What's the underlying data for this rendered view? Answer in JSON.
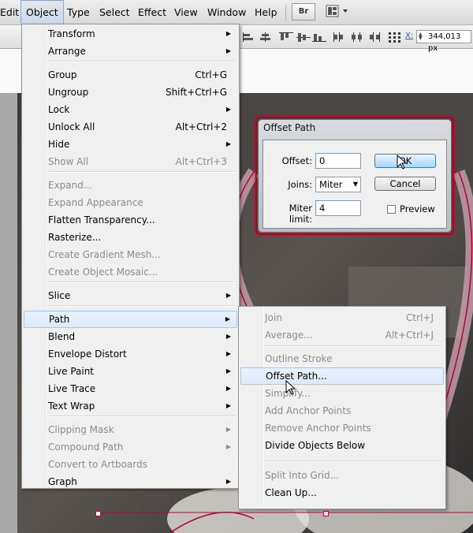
{
  "menubar": {
    "items": [
      "Edit",
      "Object",
      "Type",
      "Select",
      "Effect",
      "View",
      "Window",
      "Help"
    ],
    "active": "Object",
    "bridge_label": "Br"
  },
  "controlbar": {
    "x_label": "X:",
    "x_value": "344,013 px"
  },
  "object_menu": {
    "items": [
      {
        "label": "Transform",
        "shortcut": "",
        "submenu": true,
        "disabled": false
      },
      {
        "label": "Arrange",
        "shortcut": "",
        "submenu": true,
        "disabled": false
      },
      {
        "label": "Group",
        "shortcut": "Ctrl+G",
        "submenu": false,
        "disabled": false
      },
      {
        "label": "Ungroup",
        "shortcut": "Shift+Ctrl+G",
        "submenu": false,
        "disabled": false
      },
      {
        "label": "Lock",
        "shortcut": "",
        "submenu": true,
        "disabled": false
      },
      {
        "label": "Unlock All",
        "shortcut": "Alt+Ctrl+2",
        "submenu": false,
        "disabled": false
      },
      {
        "label": "Hide",
        "shortcut": "",
        "submenu": true,
        "disabled": false
      },
      {
        "label": "Show All",
        "shortcut": "Alt+Ctrl+3",
        "submenu": false,
        "disabled": true
      },
      {
        "label": "Expand...",
        "shortcut": "",
        "submenu": false,
        "disabled": true
      },
      {
        "label": "Expand Appearance",
        "shortcut": "",
        "submenu": false,
        "disabled": true
      },
      {
        "label": "Flatten Transparency...",
        "shortcut": "",
        "submenu": false,
        "disabled": false
      },
      {
        "label": "Rasterize...",
        "shortcut": "",
        "submenu": false,
        "disabled": false
      },
      {
        "label": "Create Gradient Mesh...",
        "shortcut": "",
        "submenu": false,
        "disabled": true
      },
      {
        "label": "Create Object Mosaic...",
        "shortcut": "",
        "submenu": false,
        "disabled": true
      },
      {
        "label": "Slice",
        "shortcut": "",
        "submenu": true,
        "disabled": false
      },
      {
        "label": "Path",
        "shortcut": "",
        "submenu": true,
        "disabled": false,
        "highlighted": true
      },
      {
        "label": "Blend",
        "shortcut": "",
        "submenu": true,
        "disabled": false
      },
      {
        "label": "Envelope Distort",
        "shortcut": "",
        "submenu": true,
        "disabled": false
      },
      {
        "label": "Live Paint",
        "shortcut": "",
        "submenu": true,
        "disabled": false
      },
      {
        "label": "Live Trace",
        "shortcut": "",
        "submenu": true,
        "disabled": false
      },
      {
        "label": "Text Wrap",
        "shortcut": "",
        "submenu": true,
        "disabled": false
      },
      {
        "label": "Clipping Mask",
        "shortcut": "",
        "submenu": true,
        "disabled": true
      },
      {
        "label": "Compound Path",
        "shortcut": "",
        "submenu": true,
        "disabled": true
      },
      {
        "label": "Convert to Artboards",
        "shortcut": "",
        "submenu": false,
        "disabled": true
      },
      {
        "label": "Graph",
        "shortcut": "",
        "submenu": true,
        "disabled": false
      }
    ]
  },
  "path_menu": {
    "items": [
      {
        "label": "Join",
        "shortcut": "Ctrl+J",
        "disabled": true
      },
      {
        "label": "Average...",
        "shortcut": "Alt+Ctrl+J",
        "disabled": true
      },
      {
        "label": "Outline Stroke",
        "shortcut": "",
        "disabled": true
      },
      {
        "label": "Offset Path...",
        "shortcut": "",
        "disabled": false,
        "highlighted": true
      },
      {
        "label": "Simplify...",
        "shortcut": "",
        "disabled": true
      },
      {
        "label": "Add Anchor Points",
        "shortcut": "",
        "disabled": true
      },
      {
        "label": "Remove Anchor Points",
        "shortcut": "",
        "disabled": true
      },
      {
        "label": "Divide Objects Below",
        "shortcut": "",
        "disabled": false
      },
      {
        "label": "Split Into Grid...",
        "shortcut": "",
        "disabled": true
      },
      {
        "label": "Clean Up...",
        "shortcut": "",
        "disabled": false
      }
    ]
  },
  "dialog": {
    "title": "Offset Path",
    "offset_label": "Offset:",
    "offset_value": "0",
    "joins_label": "Joins:",
    "joins_value": "Miter",
    "miter_label": "Miter limit:",
    "miter_value": "4",
    "ok_label": "OK",
    "cancel_label": "Cancel",
    "preview_label": "Preview",
    "preview_checked": false
  },
  "colors": {
    "selection": "#c0003a",
    "highlight": "#dce9f9"
  }
}
